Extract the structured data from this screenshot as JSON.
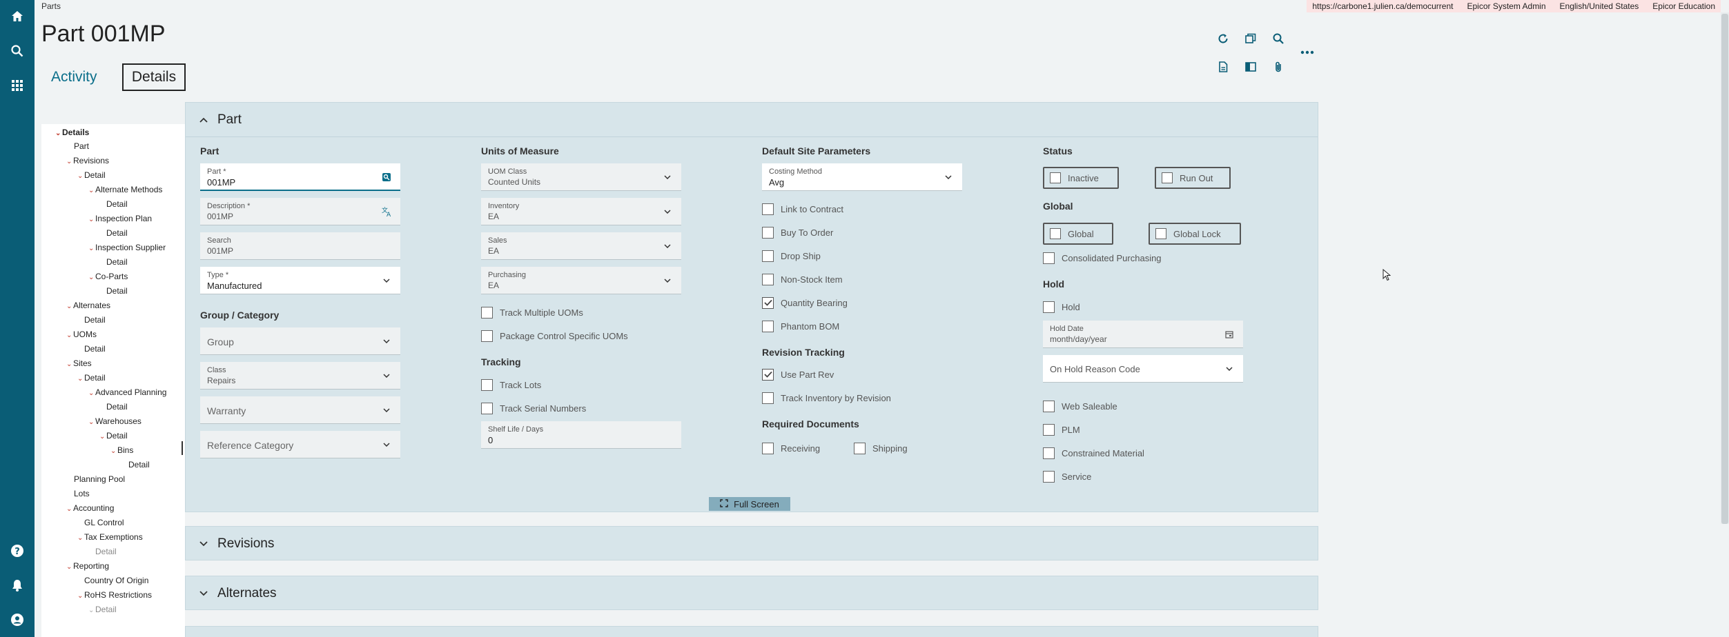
{
  "breadcrumb": "Parts",
  "env": {
    "url": "https://carbone1.julien.ca/democurrent",
    "user": "Epicor System Admin",
    "locale": "English/United States",
    "product": "Epicor Education"
  },
  "page_title": "Part 001MP",
  "tabs": {
    "activity": "Activity",
    "details": "Details"
  },
  "tree": {
    "details": "Details",
    "part": "Part",
    "revisions": "Revisions",
    "detail": "Detail",
    "alternate_methods": "Alternate Methods",
    "inspection_plan": "Inspection Plan",
    "inspection_supplier": "Inspection Supplier",
    "co_parts": "Co-Parts",
    "alternates": "Alternates",
    "uoms": "UOMs",
    "sites": "Sites",
    "advanced_planning": "Advanced Planning",
    "warehouses": "Warehouses",
    "bins": "Bins",
    "planning_pool": "Planning Pool",
    "lots": "Lots",
    "accounting": "Accounting",
    "gl_control": "GL Control",
    "tax_exemptions": "Tax Exemptions",
    "reporting": "Reporting",
    "country_of_origin": "Country Of Origin",
    "rohs_restrictions": "RoHS Restrictions"
  },
  "panels": {
    "part": "Part",
    "revisions": "Revisions",
    "alternates": "Alternates"
  },
  "part_col": {
    "heading": "Part",
    "part_label": "Part *",
    "part_value": "001MP",
    "desc_label": "Description *",
    "desc_value": "001MP",
    "search_label": "Search",
    "search_value": "001MP",
    "type_label": "Type *",
    "type_value": "Manufactured",
    "group_heading": "Group / Category",
    "group": "Group",
    "class_label": "Class",
    "class_value": "Repairs",
    "warranty": "Warranty",
    "ref_category": "Reference Category"
  },
  "uom_col": {
    "heading": "Units of Measure",
    "uom_class_label": "UOM Class",
    "uom_class_value": "Counted Units",
    "inventory_label": "Inventory",
    "inventory_value": "EA",
    "sales_label": "Sales",
    "sales_value": "EA",
    "purchasing_label": "Purchasing",
    "purchasing_value": "EA",
    "track_multiple_uoms": "Track Multiple UOMs",
    "package_control": "Package Control Specific UOMs",
    "tracking_heading": "Tracking",
    "track_lots": "Track Lots",
    "track_serial": "Track Serial Numbers",
    "shelf_life_label": "Shelf Life / Days",
    "shelf_life_value": "0"
  },
  "site_col": {
    "heading": "Default Site Parameters",
    "costing_label": "Costing Method",
    "costing_value": "Avg",
    "link_contract": "Link to Contract",
    "buy_to_order": "Buy To Order",
    "drop_ship": "Drop Ship",
    "non_stock": "Non-Stock Item",
    "quantity_bearing": "Quantity Bearing",
    "phantom_bom": "Phantom BOM",
    "rev_heading": "Revision Tracking",
    "use_part_rev": "Use Part Rev",
    "track_inv_rev": "Track Inventory by Revision",
    "req_docs_heading": "Required Documents",
    "receiving": "Receiving",
    "shipping": "Shipping"
  },
  "status_col": {
    "heading": "Status",
    "inactive": "Inactive",
    "run_out": "Run Out",
    "global_heading": "Global",
    "global": "Global",
    "global_lock": "Global Lock",
    "consolidated": "Consolidated Purchasing",
    "hold_heading": "Hold",
    "hold": "Hold",
    "hold_date_label": "Hold Date",
    "hold_date_placeholder": "month/day/year",
    "hold_reason": "On Hold Reason Code",
    "web_saleable": "Web Saleable",
    "plm": "PLM",
    "constrained": "Constrained Material",
    "service": "Service"
  },
  "checked": {
    "quantity_bearing": true,
    "use_part_rev": true
  },
  "full_screen": "Full Screen",
  "colors": {
    "rail": "#0a5d76",
    "panel": "#d7e5ea",
    "accent": "#0a6e8a"
  }
}
